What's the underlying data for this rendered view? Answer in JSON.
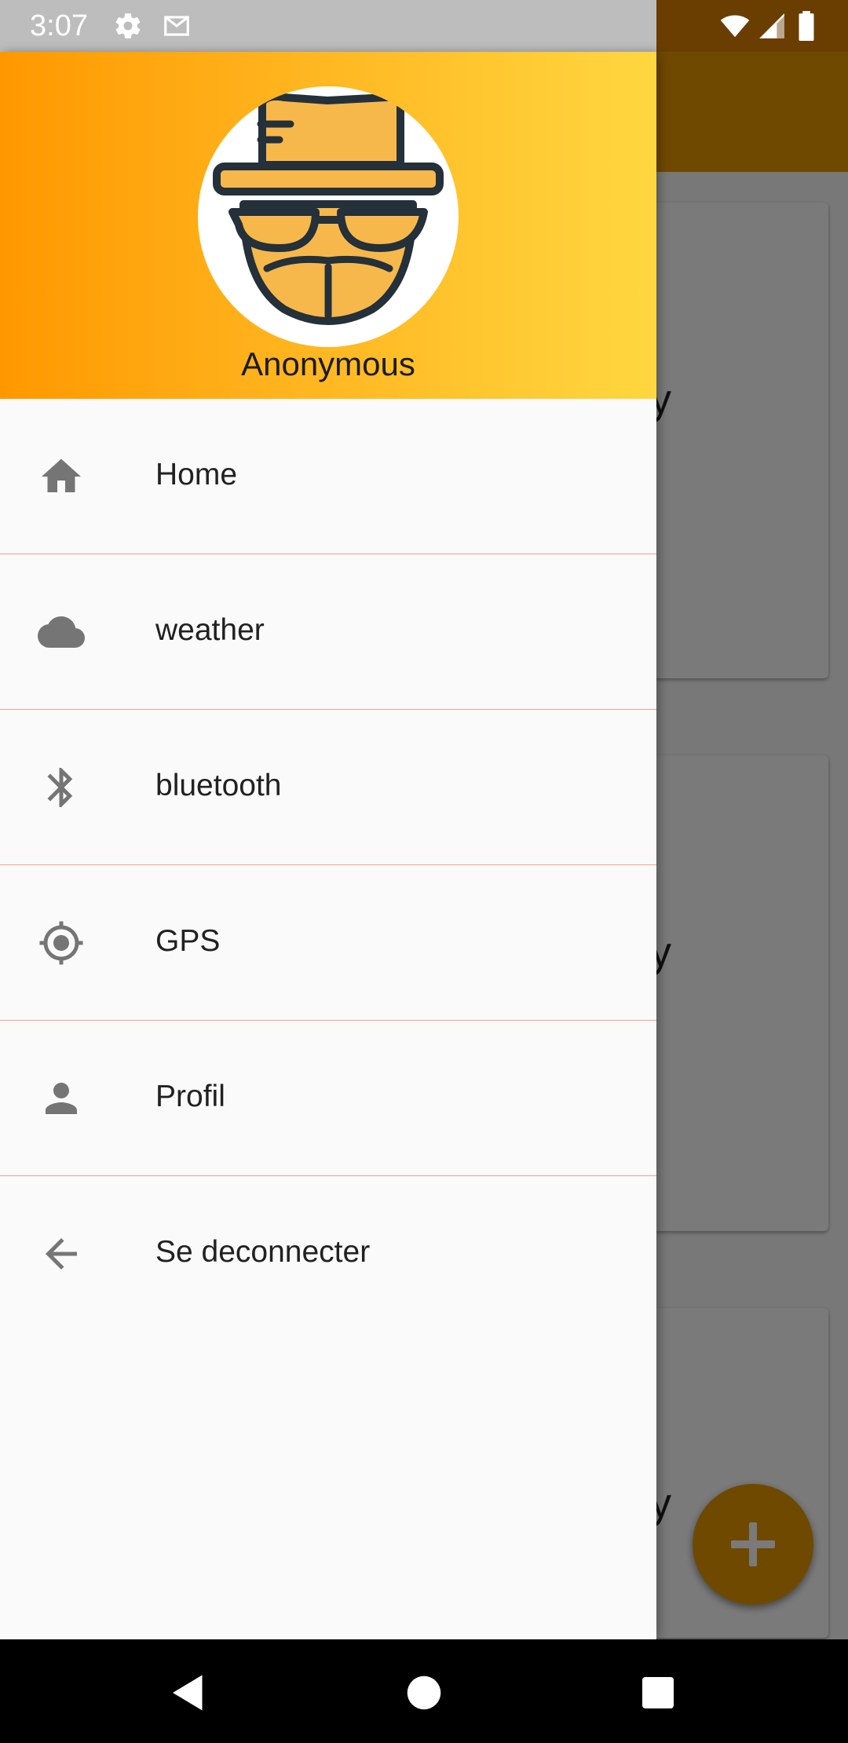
{
  "status_bar": {
    "time": "3:07",
    "left_icons": [
      "gear-icon",
      "mail-icon"
    ],
    "right_icons": [
      "wifi-icon",
      "signal-icon",
      "battery-icon"
    ]
  },
  "background_app": {
    "card_texts": [
      "ky",
      "ky",
      "ky"
    ],
    "fab_icon": "plus-icon"
  },
  "drawer": {
    "header": {
      "user_name": "Anonymous",
      "avatar_icon": "incognito-avatar-icon"
    },
    "menu_items": [
      {
        "label": "Home",
        "icon": "home-icon"
      },
      {
        "label": "weather",
        "icon": "cloud-icon"
      },
      {
        "label": "bluetooth",
        "icon": "bluetooth-icon"
      },
      {
        "label": "GPS",
        "icon": "gps-icon"
      },
      {
        "label": "Profil",
        "icon": "person-icon"
      },
      {
        "label": "Se deconnecter",
        "icon": "arrow-back-icon"
      }
    ]
  },
  "nav_bar": {
    "buttons": [
      "back-icon",
      "home-circle-icon",
      "recents-icon"
    ]
  },
  "colors": {
    "header_gradient_start": "#ff9800",
    "header_gradient_end": "#ffd740",
    "divider": "#f4a08a",
    "app_accent": "#ea9a00"
  }
}
